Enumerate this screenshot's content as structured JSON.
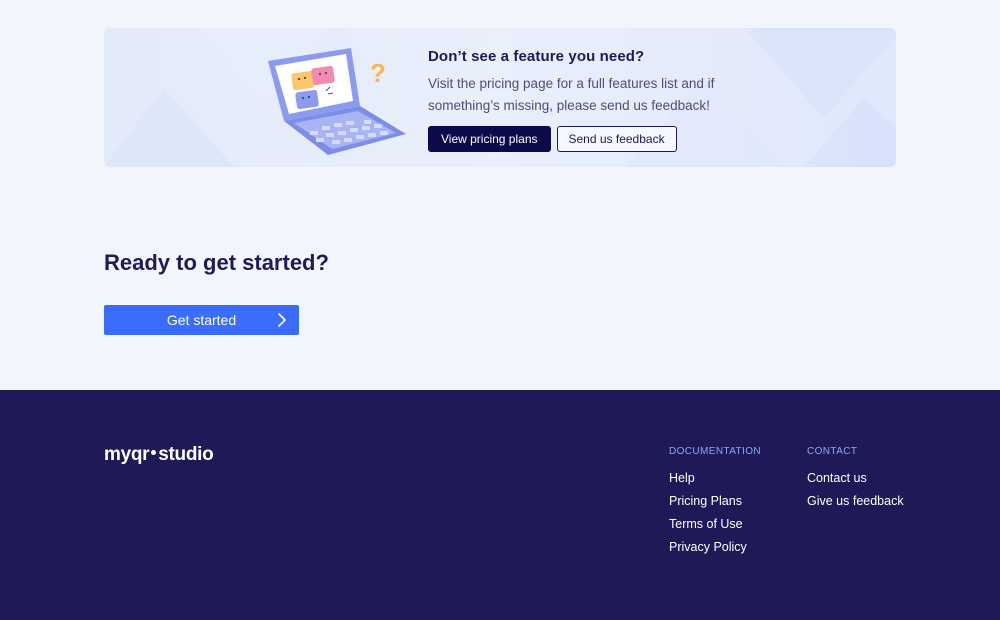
{
  "banner": {
    "title": "Don’t see a feature you need?",
    "description": "Visit the pricing page for a full features list and if something’s missing, please send us feedback!",
    "primary_button": "View pricing plans",
    "secondary_button": "Send us feedback",
    "illustration_icon": "laptop-puzzle-illustration"
  },
  "cta": {
    "title": "Ready to get started?",
    "button_label": "Get started",
    "button_icon": "chevron-right-icon"
  },
  "footer": {
    "logo_left": "myqr",
    "logo_right": "studio",
    "documentation": {
      "heading": "DOCUMENTATION",
      "links": [
        "Help",
        "Pricing Plans",
        "Terms of Use",
        "Privacy Policy"
      ]
    },
    "contact": {
      "heading": "CONTACT",
      "links": [
        "Contact us",
        "Give us feedback"
      ]
    }
  },
  "colors": {
    "page_bg": "#f2f6fc",
    "banner_bg": "#e5ecfa",
    "primary_dark": "#0c0a4a",
    "cta_blue": "#3a6dfc",
    "footer_bg": "#1d1a57",
    "footer_heading": "#8ea6f5"
  }
}
